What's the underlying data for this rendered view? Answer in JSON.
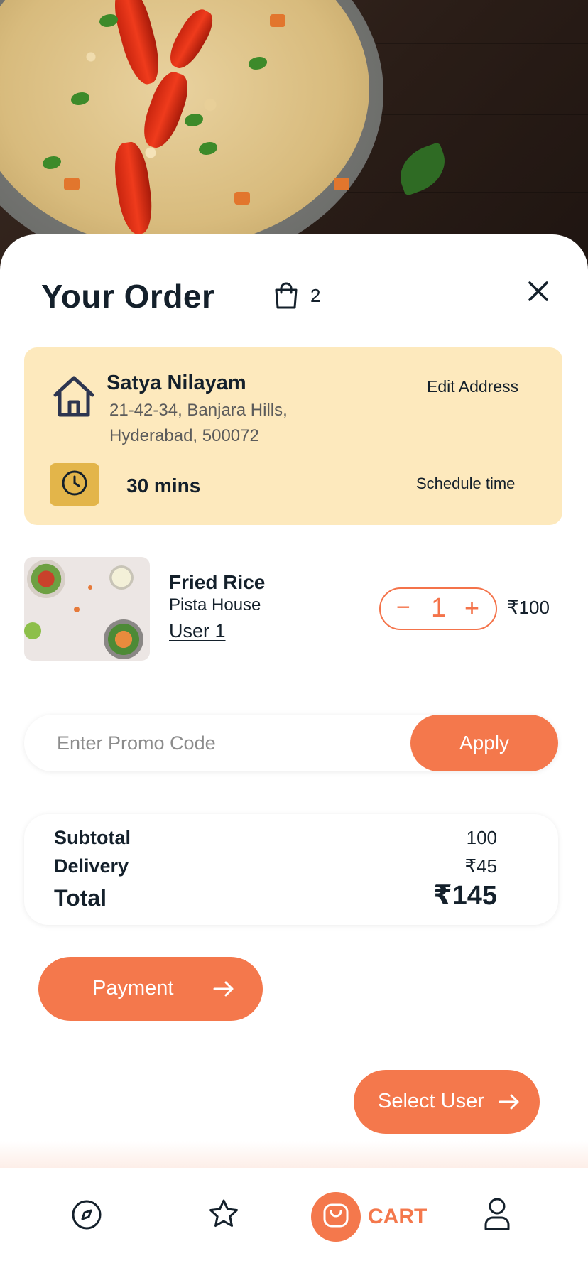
{
  "header": {
    "title": "Your Order",
    "cart_count": "2"
  },
  "address": {
    "name": "Satya Nilayam",
    "line1": "21-42-34, Banjara Hills,",
    "line2": "Hyderabad, 500072",
    "edit_label": "Edit Address",
    "eta": "30 mins",
    "schedule_label": "Schedule time"
  },
  "items": [
    {
      "name": "Fried Rice",
      "vendor": "Pista House",
      "user": "User 1",
      "quantity": "1",
      "minus_label": "−",
      "plus_label": "+",
      "price": "₹100"
    }
  ],
  "promo": {
    "placeholder": "Enter Promo Code",
    "apply_label": "Apply"
  },
  "totals": {
    "subtotal_label": "Subtotal",
    "subtotal_value": "100",
    "delivery_label": "Delivery",
    "delivery_value": "₹45",
    "total_label": "Total",
    "total_value": "₹145"
  },
  "actions": {
    "payment_label": "Payment",
    "select_user_label": "Select User"
  },
  "nav": {
    "items": [
      {
        "icon": "compass-icon",
        "active": false
      },
      {
        "icon": "star-icon",
        "active": false
      },
      {
        "icon": "cart-icon",
        "label": "CART",
        "active": true
      },
      {
        "icon": "user-icon",
        "active": false
      }
    ]
  },
  "colors": {
    "accent": "#f4784c",
    "address_card_bg": "#fde9bd",
    "clock_box_bg": "#e3b54a",
    "text_dark": "#14202b"
  }
}
